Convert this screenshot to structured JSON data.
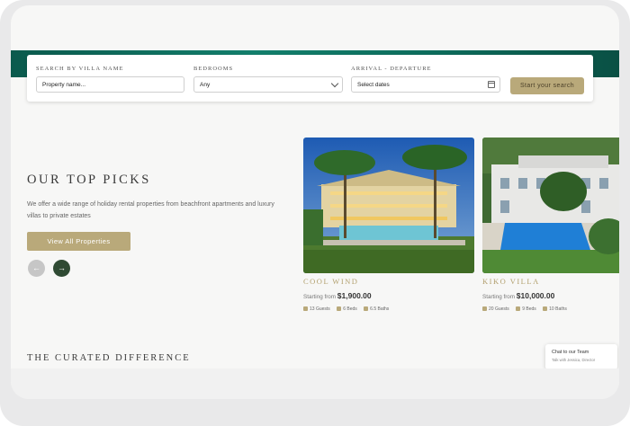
{
  "search": {
    "name_label": "SEARCH BY VILLA NAME",
    "name_value": "Property name...",
    "bedrooms_label": "BEDROOMS",
    "bedrooms_value": "Any",
    "dates_label": "ARRIVAL - DEPARTURE",
    "dates_value": "Select dates",
    "submit_label": "Start your search"
  },
  "top_picks": {
    "heading": "OUR TOP PICKS",
    "description": "We offer a wide range of holiday rental properties from beachfront apartments and luxury villas to private estates",
    "view_all_label": "View All Properties",
    "prev_icon": "←",
    "next_icon": "→"
  },
  "properties": [
    {
      "name": "COOL WIND",
      "price_prefix": "Starting from",
      "price": "$1,900.00",
      "guests": "13 Guests",
      "beds": "6 Beds",
      "baths": "6.5 Baths"
    },
    {
      "name": "KIKO VILLA",
      "price_prefix": "Starting from",
      "price": "$10,000.00",
      "guests": "20 Guests",
      "beds": "9 Beds",
      "baths": "10 Baths"
    }
  ],
  "curated": {
    "heading": "THE CURATED DIFFERENCE"
  },
  "chat": {
    "title": "Chat to our Team",
    "subtitle": "Talk with Jessica, Director"
  },
  "colors": {
    "accent_gold": "#b9a97a",
    "dark_green": "#2f4a33",
    "hero_teal": "#0d6d5c"
  },
  "icons": {
    "guests": "guests-icon",
    "beds": "bed-icon",
    "baths": "bath-icon",
    "calendar": "calendar-icon",
    "dropdown": "chevron-down-icon"
  }
}
